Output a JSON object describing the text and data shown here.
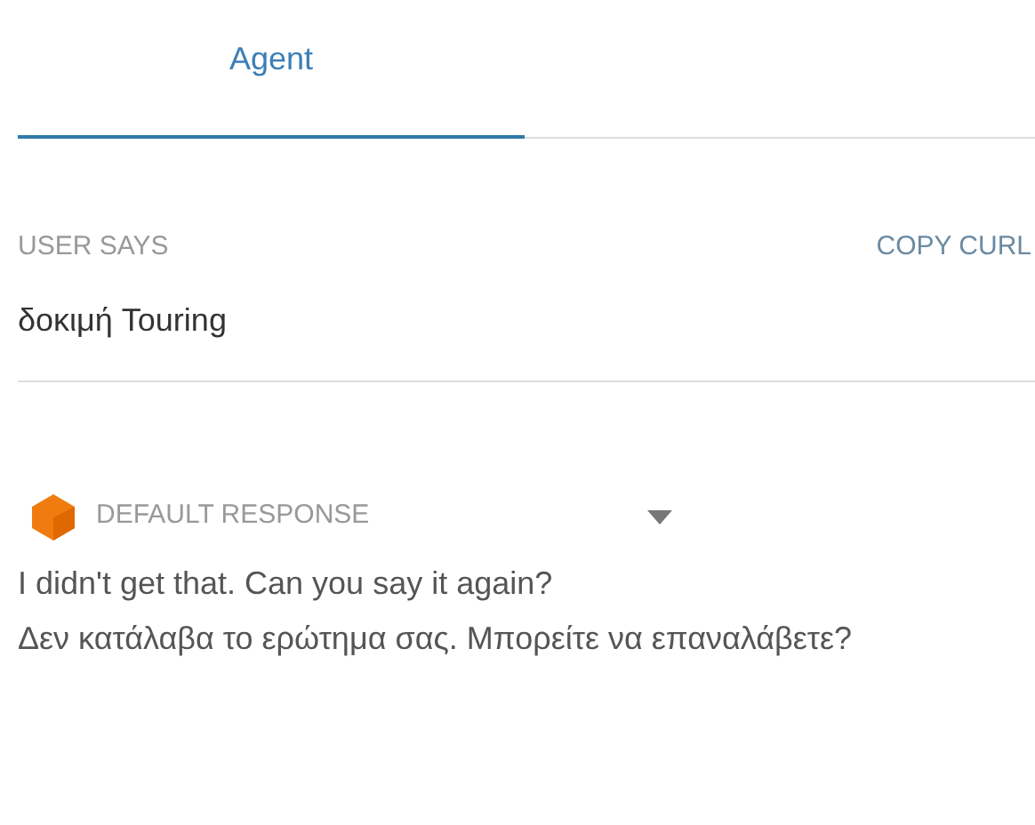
{
  "tabs": [
    {
      "label": "Agent",
      "selected": true
    }
  ],
  "user_says": {
    "label": "USER SAYS",
    "action": "COPY CURL",
    "text": "δοκιμή Touring"
  },
  "response": {
    "label": "DEFAULT RESPONSE",
    "expanded": false,
    "messages": [
      "I didn't get that. Can you say it again?",
      "Δεν κατάλαβα το ερώτημα σας. Μπορείτε να επαναλάβετε?"
    ]
  }
}
